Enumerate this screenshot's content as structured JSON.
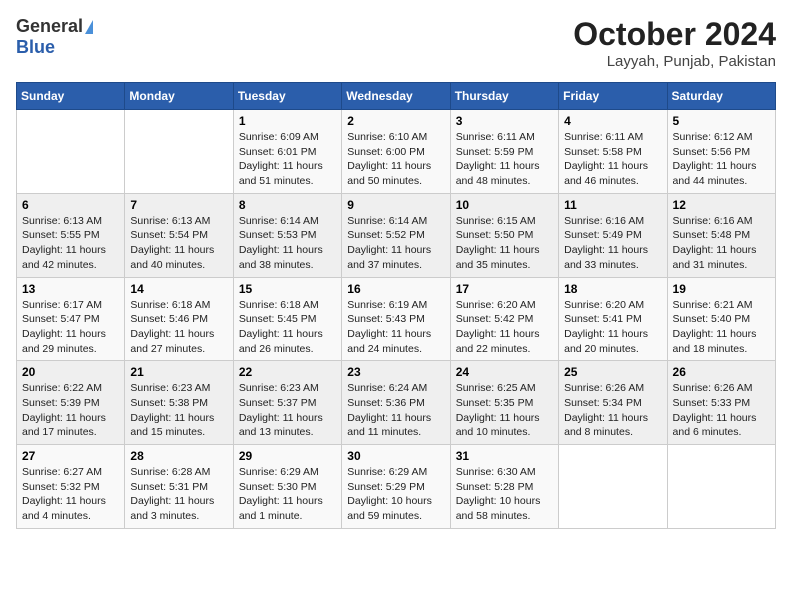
{
  "logo": {
    "general": "General",
    "blue": "Blue"
  },
  "title": "October 2024",
  "location": "Layyah, Punjab, Pakistan",
  "weekdays": [
    "Sunday",
    "Monday",
    "Tuesday",
    "Wednesday",
    "Thursday",
    "Friday",
    "Saturday"
  ],
  "weeks": [
    [
      {
        "day": "",
        "sunrise": "",
        "sunset": "",
        "daylight": ""
      },
      {
        "day": "",
        "sunrise": "",
        "sunset": "",
        "daylight": ""
      },
      {
        "day": "1",
        "sunrise": "Sunrise: 6:09 AM",
        "sunset": "Sunset: 6:01 PM",
        "daylight": "Daylight: 11 hours and 51 minutes."
      },
      {
        "day": "2",
        "sunrise": "Sunrise: 6:10 AM",
        "sunset": "Sunset: 6:00 PM",
        "daylight": "Daylight: 11 hours and 50 minutes."
      },
      {
        "day": "3",
        "sunrise": "Sunrise: 6:11 AM",
        "sunset": "Sunset: 5:59 PM",
        "daylight": "Daylight: 11 hours and 48 minutes."
      },
      {
        "day": "4",
        "sunrise": "Sunrise: 6:11 AM",
        "sunset": "Sunset: 5:58 PM",
        "daylight": "Daylight: 11 hours and 46 minutes."
      },
      {
        "day": "5",
        "sunrise": "Sunrise: 6:12 AM",
        "sunset": "Sunset: 5:56 PM",
        "daylight": "Daylight: 11 hours and 44 minutes."
      }
    ],
    [
      {
        "day": "6",
        "sunrise": "Sunrise: 6:13 AM",
        "sunset": "Sunset: 5:55 PM",
        "daylight": "Daylight: 11 hours and 42 minutes."
      },
      {
        "day": "7",
        "sunrise": "Sunrise: 6:13 AM",
        "sunset": "Sunset: 5:54 PM",
        "daylight": "Daylight: 11 hours and 40 minutes."
      },
      {
        "day": "8",
        "sunrise": "Sunrise: 6:14 AM",
        "sunset": "Sunset: 5:53 PM",
        "daylight": "Daylight: 11 hours and 38 minutes."
      },
      {
        "day": "9",
        "sunrise": "Sunrise: 6:14 AM",
        "sunset": "Sunset: 5:52 PM",
        "daylight": "Daylight: 11 hours and 37 minutes."
      },
      {
        "day": "10",
        "sunrise": "Sunrise: 6:15 AM",
        "sunset": "Sunset: 5:50 PM",
        "daylight": "Daylight: 11 hours and 35 minutes."
      },
      {
        "day": "11",
        "sunrise": "Sunrise: 6:16 AM",
        "sunset": "Sunset: 5:49 PM",
        "daylight": "Daylight: 11 hours and 33 minutes."
      },
      {
        "day": "12",
        "sunrise": "Sunrise: 6:16 AM",
        "sunset": "Sunset: 5:48 PM",
        "daylight": "Daylight: 11 hours and 31 minutes."
      }
    ],
    [
      {
        "day": "13",
        "sunrise": "Sunrise: 6:17 AM",
        "sunset": "Sunset: 5:47 PM",
        "daylight": "Daylight: 11 hours and 29 minutes."
      },
      {
        "day": "14",
        "sunrise": "Sunrise: 6:18 AM",
        "sunset": "Sunset: 5:46 PM",
        "daylight": "Daylight: 11 hours and 27 minutes."
      },
      {
        "day": "15",
        "sunrise": "Sunrise: 6:18 AM",
        "sunset": "Sunset: 5:45 PM",
        "daylight": "Daylight: 11 hours and 26 minutes."
      },
      {
        "day": "16",
        "sunrise": "Sunrise: 6:19 AM",
        "sunset": "Sunset: 5:43 PM",
        "daylight": "Daylight: 11 hours and 24 minutes."
      },
      {
        "day": "17",
        "sunrise": "Sunrise: 6:20 AM",
        "sunset": "Sunset: 5:42 PM",
        "daylight": "Daylight: 11 hours and 22 minutes."
      },
      {
        "day": "18",
        "sunrise": "Sunrise: 6:20 AM",
        "sunset": "Sunset: 5:41 PM",
        "daylight": "Daylight: 11 hours and 20 minutes."
      },
      {
        "day": "19",
        "sunrise": "Sunrise: 6:21 AM",
        "sunset": "Sunset: 5:40 PM",
        "daylight": "Daylight: 11 hours and 18 minutes."
      }
    ],
    [
      {
        "day": "20",
        "sunrise": "Sunrise: 6:22 AM",
        "sunset": "Sunset: 5:39 PM",
        "daylight": "Daylight: 11 hours and 17 minutes."
      },
      {
        "day": "21",
        "sunrise": "Sunrise: 6:23 AM",
        "sunset": "Sunset: 5:38 PM",
        "daylight": "Daylight: 11 hours and 15 minutes."
      },
      {
        "day": "22",
        "sunrise": "Sunrise: 6:23 AM",
        "sunset": "Sunset: 5:37 PM",
        "daylight": "Daylight: 11 hours and 13 minutes."
      },
      {
        "day": "23",
        "sunrise": "Sunrise: 6:24 AM",
        "sunset": "Sunset: 5:36 PM",
        "daylight": "Daylight: 11 hours and 11 minutes."
      },
      {
        "day": "24",
        "sunrise": "Sunrise: 6:25 AM",
        "sunset": "Sunset: 5:35 PM",
        "daylight": "Daylight: 11 hours and 10 minutes."
      },
      {
        "day": "25",
        "sunrise": "Sunrise: 6:26 AM",
        "sunset": "Sunset: 5:34 PM",
        "daylight": "Daylight: 11 hours and 8 minutes."
      },
      {
        "day": "26",
        "sunrise": "Sunrise: 6:26 AM",
        "sunset": "Sunset: 5:33 PM",
        "daylight": "Daylight: 11 hours and 6 minutes."
      }
    ],
    [
      {
        "day": "27",
        "sunrise": "Sunrise: 6:27 AM",
        "sunset": "Sunset: 5:32 PM",
        "daylight": "Daylight: 11 hours and 4 minutes."
      },
      {
        "day": "28",
        "sunrise": "Sunrise: 6:28 AM",
        "sunset": "Sunset: 5:31 PM",
        "daylight": "Daylight: 11 hours and 3 minutes."
      },
      {
        "day": "29",
        "sunrise": "Sunrise: 6:29 AM",
        "sunset": "Sunset: 5:30 PM",
        "daylight": "Daylight: 11 hours and 1 minute."
      },
      {
        "day": "30",
        "sunrise": "Sunrise: 6:29 AM",
        "sunset": "Sunset: 5:29 PM",
        "daylight": "Daylight: 10 hours and 59 minutes."
      },
      {
        "day": "31",
        "sunrise": "Sunrise: 6:30 AM",
        "sunset": "Sunset: 5:28 PM",
        "daylight": "Daylight: 10 hours and 58 minutes."
      },
      {
        "day": "",
        "sunrise": "",
        "sunset": "",
        "daylight": ""
      },
      {
        "day": "",
        "sunrise": "",
        "sunset": "",
        "daylight": ""
      }
    ]
  ]
}
